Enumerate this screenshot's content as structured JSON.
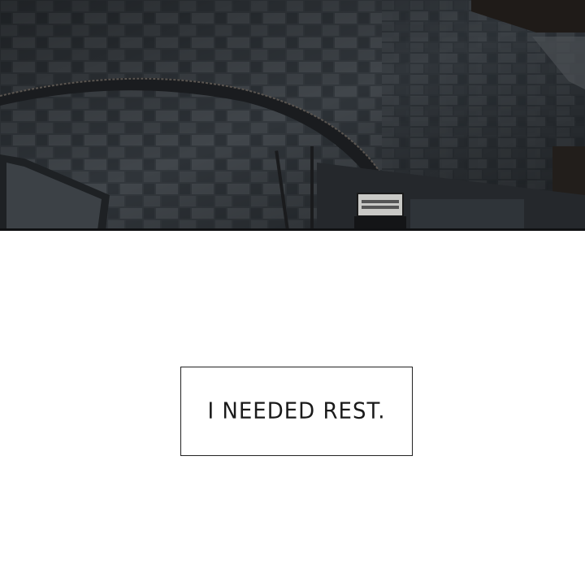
{
  "panel": {
    "illustration_icon": "courtyard-stone-floor-night",
    "colors": {
      "background": "#ffffff",
      "stone_dark": "#2a2e33",
      "stone_mid": "#3a3f44",
      "stone_light": "#4a5055",
      "border": "#111214"
    }
  },
  "caption": {
    "text": "I NEEDED REST."
  }
}
